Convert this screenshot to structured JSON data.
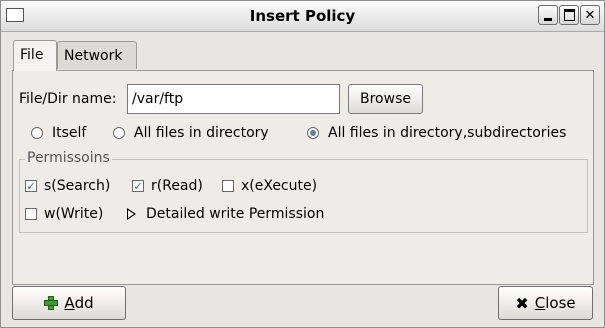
{
  "window": {
    "title": "Insert Policy"
  },
  "tabs": [
    {
      "label": "File",
      "selected": true
    },
    {
      "label": "Network",
      "selected": false
    }
  ],
  "file": {
    "label": "File/Dir name:",
    "value": "/var/ftp",
    "browse_label": "Browse"
  },
  "scope": {
    "options": [
      {
        "label": "Itself",
        "selected": false
      },
      {
        "label": "All files in directory",
        "selected": false
      },
      {
        "label": "All files in directory,subdirectories",
        "selected": true
      }
    ]
  },
  "permissions": {
    "legend": "Permissoins",
    "items": [
      {
        "label": "s(Search)",
        "checked": true
      },
      {
        "label": "r(Read)",
        "checked": true
      },
      {
        "label": "x(eXecute)",
        "checked": false
      },
      {
        "label": "w(Write)",
        "checked": false
      }
    ],
    "detail_label": "Detailed write Permission"
  },
  "actions": {
    "add_mnemonic": "A",
    "add_rest": "dd",
    "close_mnemonic": "C",
    "close_rest": "lose"
  },
  "icons": {
    "add": "plus-icon",
    "close": "x-icon",
    "expander": "triangle-right-icon",
    "checkmark_color": "#3a6fb8",
    "radio_dot_color": "#5b7fb6"
  }
}
